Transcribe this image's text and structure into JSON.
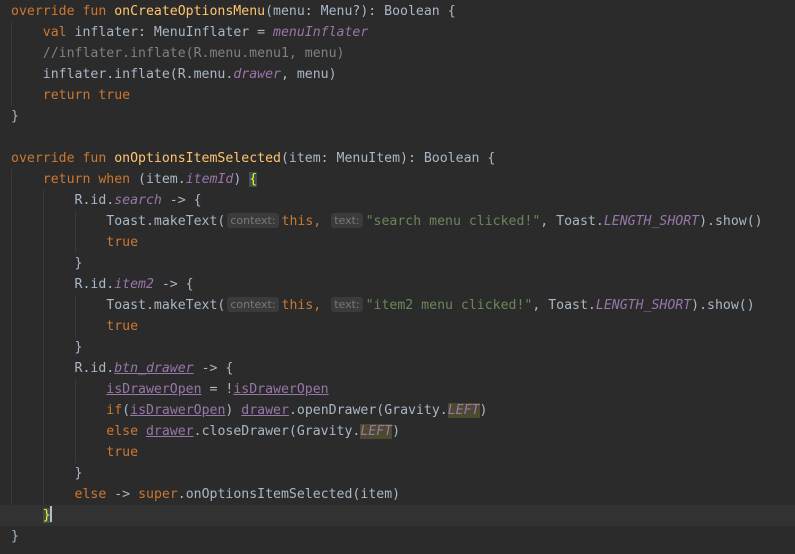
{
  "editor": {
    "lines": [
      [
        {
          "t": "override fun ",
          "c": "kw"
        },
        {
          "t": "onCreateOptionsMenu",
          "c": "fn"
        },
        {
          "t": "(menu: Menu?): Boolean {"
        }
      ],
      [
        {
          "t": "    "
        },
        {
          "t": "val ",
          "c": "kw"
        },
        {
          "t": "inflater: MenuInflater = "
        },
        {
          "t": "menuInflater",
          "c": "prop"
        }
      ],
      [
        {
          "t": "    //inflater.inflate(R.menu.menu1, menu)",
          "c": "cm"
        }
      ],
      [
        {
          "t": "    inflater.inflate(R.menu."
        },
        {
          "t": "drawer",
          "c": "prop"
        },
        {
          "t": ", menu)"
        }
      ],
      [
        {
          "t": "    "
        },
        {
          "t": "return true",
          "c": "kw"
        }
      ],
      [
        {
          "t": "}"
        }
      ],
      [],
      [
        {
          "t": "override fun ",
          "c": "kw"
        },
        {
          "t": "onOptionsItemSelected",
          "c": "fn"
        },
        {
          "t": "(item: MenuItem): Boolean {"
        }
      ],
      [
        {
          "t": "    "
        },
        {
          "t": "return when ",
          "c": "kw"
        },
        {
          "t": "(item."
        },
        {
          "t": "itemId",
          "c": "prop"
        },
        {
          "t": ") "
        },
        {
          "t": "{",
          "c": "brace-hl"
        }
      ],
      [
        {
          "t": "        R.id."
        },
        {
          "t": "search",
          "c": "prop"
        },
        {
          "t": " -> {"
        }
      ],
      [
        {
          "t": "            Toast.makeText("
        },
        {
          "h": "context:"
        },
        {
          "t": "this, ",
          "c": "kw"
        },
        {
          "h": "text:"
        },
        {
          "t": "\"search menu clicked!\"",
          "c": "str"
        },
        {
          "t": ", Toast."
        },
        {
          "t": "LENGTH_SHORT",
          "c": "prop"
        },
        {
          "t": ").show()"
        }
      ],
      [
        {
          "t": "            "
        },
        {
          "t": "true",
          "c": "kw"
        }
      ],
      [
        {
          "t": "        }"
        }
      ],
      [
        {
          "t": "        R.id."
        },
        {
          "t": "item2",
          "c": "prop"
        },
        {
          "t": " -> {"
        }
      ],
      [
        {
          "t": "            Toast.makeText("
        },
        {
          "h": "context:"
        },
        {
          "t": "this, ",
          "c": "kw"
        },
        {
          "h": "text:"
        },
        {
          "t": "\"item2 menu clicked!\"",
          "c": "str"
        },
        {
          "t": ", Toast."
        },
        {
          "t": "LENGTH_SHORT",
          "c": "prop"
        },
        {
          "t": ").show()"
        }
      ],
      [
        {
          "t": "            "
        },
        {
          "t": "true",
          "c": "kw"
        }
      ],
      [
        {
          "t": "        }"
        }
      ],
      [
        {
          "t": "        R.id."
        },
        {
          "t": "btn_drawer",
          "c": "prop und"
        },
        {
          "t": " -> {"
        }
      ],
      [
        {
          "t": "            "
        },
        {
          "t": "isDrawerOpen",
          "c": "var"
        },
        {
          "t": " = !"
        },
        {
          "t": "isDrawerOpen",
          "c": "var"
        }
      ],
      [
        {
          "t": "            "
        },
        {
          "t": "if",
          "c": "kw"
        },
        {
          "t": "("
        },
        {
          "t": "isDrawerOpen",
          "c": "var"
        },
        {
          "t": ") "
        },
        {
          "t": "drawer",
          "c": "var"
        },
        {
          "t": ".openDrawer(Gravity."
        },
        {
          "t": "LEFT",
          "c": "prop warnbg"
        },
        {
          "t": ")"
        }
      ],
      [
        {
          "t": "            "
        },
        {
          "t": "else ",
          "c": "kw"
        },
        {
          "t": "drawer",
          "c": "var"
        },
        {
          "t": ".closeDrawer(Gravity."
        },
        {
          "t": "LEFT",
          "c": "prop warnbg"
        },
        {
          "t": ")"
        }
      ],
      [
        {
          "t": "            "
        },
        {
          "t": "true",
          "c": "kw"
        }
      ],
      [
        {
          "t": "        }"
        }
      ],
      [
        {
          "t": "        "
        },
        {
          "t": "else ",
          "c": "kw"
        },
        {
          "t": "-> "
        },
        {
          "t": "super",
          "c": "kw"
        },
        {
          "t": ".onOptionsItemSelected(item)"
        }
      ],
      [
        {
          "t": "    "
        },
        {
          "t": "}",
          "c": "brace-hl"
        },
        {
          "caret": true
        }
      ],
      [
        {
          "t": "}"
        }
      ]
    ],
    "caret_line": 24,
    "guides": [
      {
        "col": 0,
        "from": 1,
        "to": 4
      },
      {
        "col": 0,
        "from": 8,
        "to": 23
      },
      {
        "col": 4,
        "from": 9,
        "to": 23
      },
      {
        "col": 8,
        "from": 10,
        "to": 11
      },
      {
        "col": 8,
        "from": 14,
        "to": 15
      },
      {
        "col": 8,
        "from": 18,
        "to": 21
      }
    ]
  }
}
